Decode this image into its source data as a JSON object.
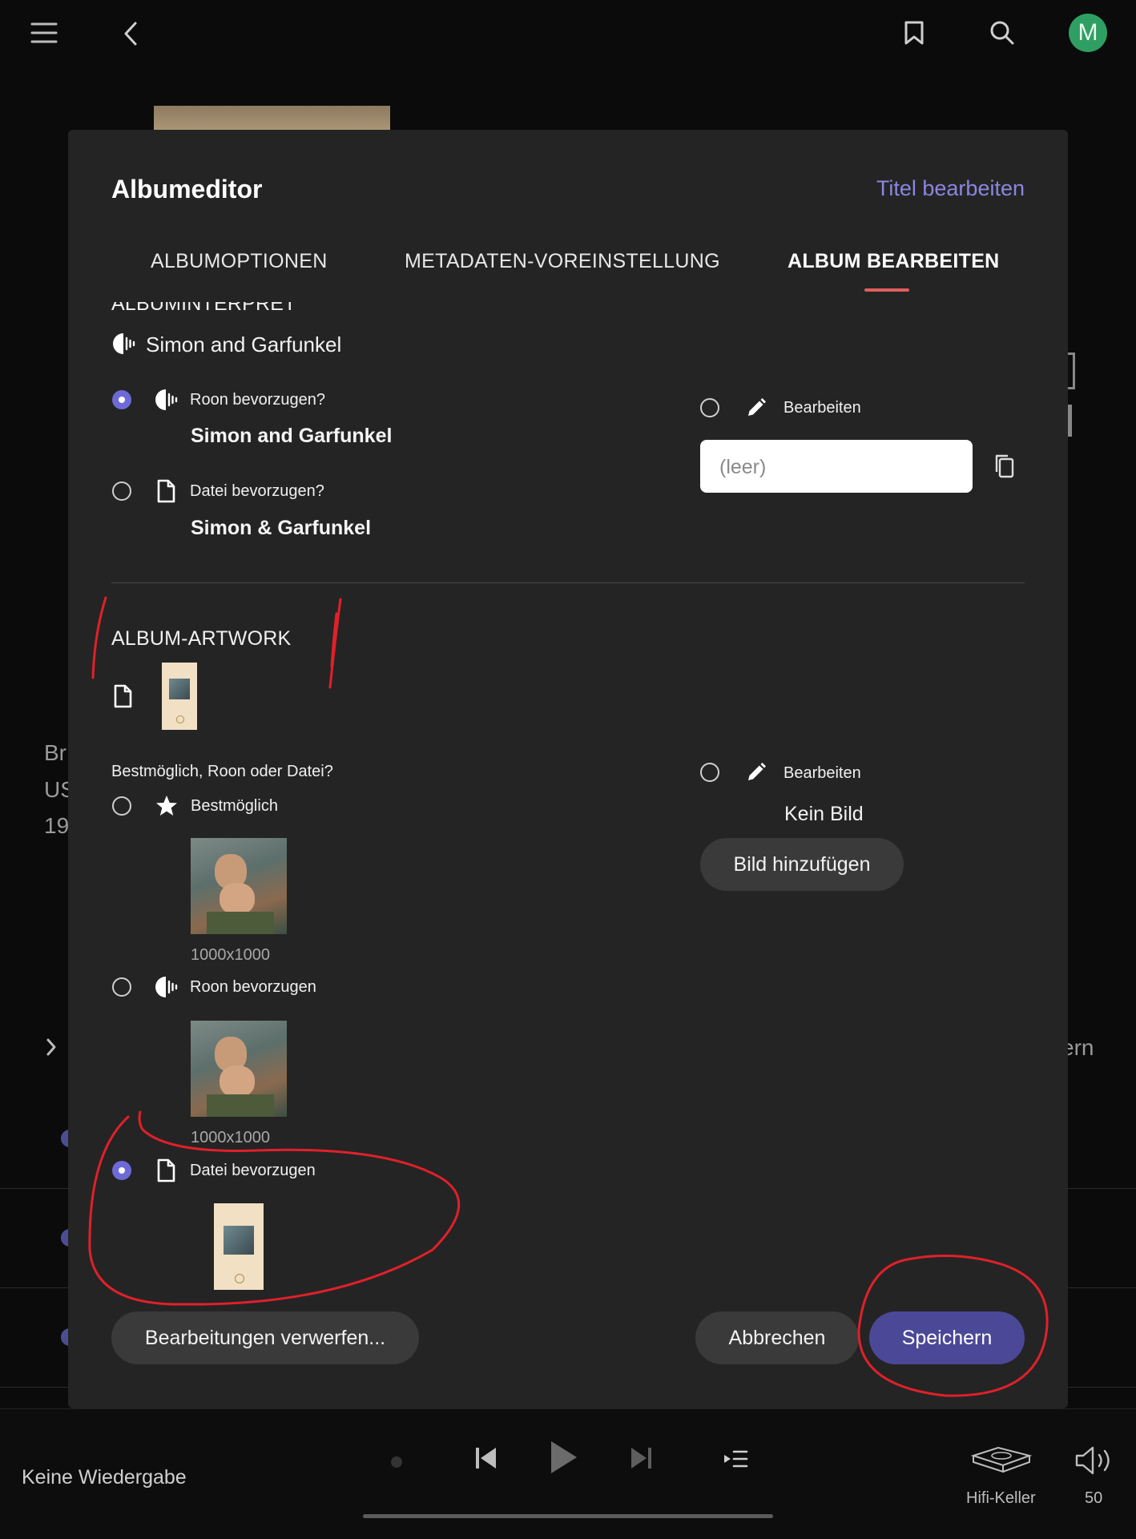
{
  "topbar": {
    "icons": [
      "menu-icon",
      "back-icon",
      "bookmark-icon",
      "search-icon"
    ],
    "avatar_letter": "M",
    "avatar_color": "#2f9e62"
  },
  "background_page": {
    "left_text": [
      "Br",
      "US",
      "19"
    ],
    "right_text": "ern"
  },
  "modal": {
    "title": "Albumeditor",
    "title_edit_link": "Titel bearbeiten",
    "tabs": [
      {
        "label": "ALBUMOPTIONEN",
        "active": false
      },
      {
        "label": "METADATEN-VOREINSTELLUNG",
        "active": false
      },
      {
        "label": "ALBUM BEARBEITEN",
        "active": true
      }
    ],
    "album_artist": {
      "heading": "ALBUMINTERPRET",
      "current_value": "Simon and Garfunkel",
      "options": [
        {
          "label": "Roon bevorzugen?",
          "value": "Simon and Garfunkel",
          "selected": true,
          "icon": "roon-icon"
        },
        {
          "label": "Datei bevorzugen?",
          "value": "Simon & Garfunkel",
          "selected": false,
          "icon": "file-icon"
        }
      ],
      "edit": {
        "label": "Bearbeiten",
        "selected": false,
        "input_placeholder": "(leer)"
      }
    },
    "artwork": {
      "heading": "ALBUM-ARTWORK",
      "question": "Bestmöglich, Roon oder Datei?",
      "options": [
        {
          "label": "Bestmöglich",
          "size": "1000x1000",
          "selected": false,
          "icon": "star-icon"
        },
        {
          "label": "Roon bevorzugen",
          "size": "1000x1000",
          "selected": false,
          "icon": "roon-icon"
        },
        {
          "label": "Datei bevorzugen",
          "selected": true,
          "icon": "file-icon"
        }
      ],
      "edit": {
        "label": "Bearbeiten",
        "selected": false,
        "no_image": "Kein Bild",
        "add_image_button": "Bild hinzufügen"
      }
    },
    "footer": {
      "discard_button": "Bearbeitungen verwerfen...",
      "cancel_button": "Abbrechen",
      "save_button": "Speichern"
    },
    "accent_color": "#6d6ad8",
    "link_color": "#8b86e0",
    "annotation_color": "#e0202a"
  },
  "player": {
    "status": "Keine Wiedergabe",
    "zone": "Hifi-Keller",
    "volume": "50"
  }
}
